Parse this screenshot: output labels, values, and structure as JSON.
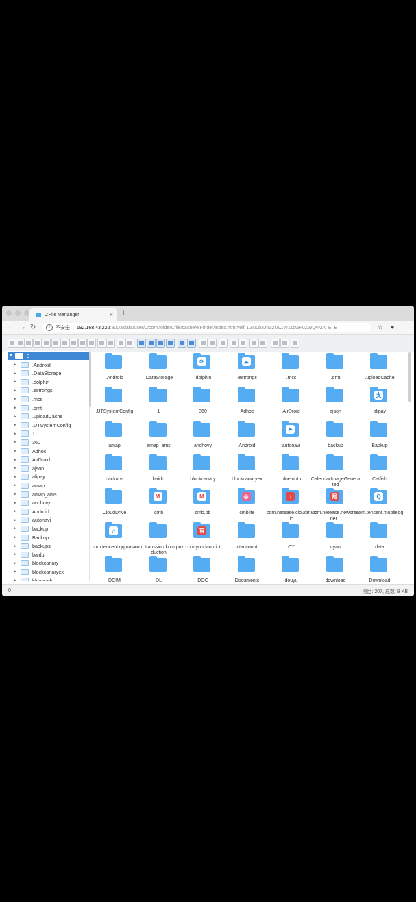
{
  "browser": {
    "tab_title": "0:File Mananger",
    "insecure_label": "不安全",
    "url_host": "192.168.43.222",
    "url_path": ":8000/data/user/0/com.folderv.file/cache/elFinder/index.html#elf_L3N0b3JhZ2UvZW11bGF0ZWQvMA_E_E"
  },
  "tree": {
    "root": "0",
    "items": [
      ".Android",
      ".DataStorage",
      ".dolphin",
      ".estrongs",
      ".mcs",
      ".qmt",
      ".uploadCache",
      ".UTSystemConfig",
      "1",
      "360",
      "Adhoc",
      "AirDroid",
      "ajson",
      "alipay",
      "amap",
      "amap_ams",
      "anchovy",
      "Android",
      "autonavi",
      "backup",
      "Backup",
      "backups",
      "baidu",
      "blockcanary",
      "blockcanaryex",
      "bluetooth"
    ]
  },
  "files": [
    {
      "name": ".Android",
      "icon": "folder-icon"
    },
    {
      "name": ".DataStorage",
      "icon": "folder-icon"
    },
    {
      "name": ".dolphin",
      "icon": "dolphin-app-icon"
    },
    {
      "name": ".estrongs",
      "icon": "estrongs-app-icon"
    },
    {
      "name": ".mcs",
      "icon": "folder-icon"
    },
    {
      "name": ".qmt",
      "icon": "folder-icon"
    },
    {
      "name": ".uploadCache",
      "icon": "folder-icon"
    },
    {
      "name": ".UTSystemConfig",
      "icon": "folder-icon"
    },
    {
      "name": "1",
      "icon": "folder-icon"
    },
    {
      "name": "360",
      "icon": "folder-icon"
    },
    {
      "name": "Adhoc",
      "icon": "folder-icon"
    },
    {
      "name": "AirDroid",
      "icon": "folder-icon"
    },
    {
      "name": "ajson",
      "icon": "folder-icon"
    },
    {
      "name": "alipay",
      "icon": "alipay-app-icon"
    },
    {
      "name": "amap",
      "icon": "folder-icon"
    },
    {
      "name": "amap_ams",
      "icon": "folder-icon"
    },
    {
      "name": "anchovy",
      "icon": "folder-icon"
    },
    {
      "name": "Android",
      "icon": "folder-icon"
    },
    {
      "name": "autonavi",
      "icon": "autonavi-app-icon"
    },
    {
      "name": "backup",
      "icon": "folder-icon"
    },
    {
      "name": "Backup",
      "icon": "folder-icon"
    },
    {
      "name": "backups",
      "icon": "folder-icon"
    },
    {
      "name": "baidu",
      "icon": "folder-icon"
    },
    {
      "name": "blockcanary",
      "icon": "folder-icon"
    },
    {
      "name": "blockcanaryex",
      "icon": "folder-icon"
    },
    {
      "name": "bluetooth",
      "icon": "folder-icon"
    },
    {
      "name": "CalendarImageGenerated",
      "icon": "folder-icon"
    },
    {
      "name": "Catfish",
      "icon": "folder-icon"
    },
    {
      "name": "CloudDrive",
      "icon": "folder-icon"
    },
    {
      "name": "cmb",
      "icon": "cmb-app-icon"
    },
    {
      "name": "cmb.pb",
      "icon": "cmb-app-icon"
    },
    {
      "name": "cmblife",
      "icon": "cmblife-app-icon"
    },
    {
      "name": "com.netease.cloudmusic",
      "icon": "cloudmusic-app-icon"
    },
    {
      "name": "com.netease.newsreader...",
      "icon": "newsreader-app-icon"
    },
    {
      "name": "com.tencent.mobileqq",
      "icon": "qq-app-icon"
    },
    {
      "name": "com.tencent.qqmusic",
      "icon": "qqmusic-app-icon"
    },
    {
      "name": "com.transsion.kom.production",
      "icon": "folder-icon"
    },
    {
      "name": "com.youdao.dict",
      "icon": "youdao-app-icon"
    },
    {
      "name": "ctaccount",
      "icon": "folder-icon"
    },
    {
      "name": "CY",
      "icon": "folder-icon"
    },
    {
      "name": "cyan",
      "icon": "folder-icon"
    },
    {
      "name": "data",
      "icon": "folder-icon"
    },
    {
      "name": "DCIM",
      "icon": "folder-icon"
    },
    {
      "name": "DL",
      "icon": "folder-icon"
    },
    {
      "name": "DOC",
      "icon": "folder-icon"
    },
    {
      "name": "Documents",
      "icon": "folder-icon"
    },
    {
      "name": "douyu",
      "icon": "folder-icon"
    },
    {
      "name": "download",
      "icon": "folder-icon"
    },
    {
      "name": "Download",
      "icon": "folder-icon"
    }
  ],
  "status": {
    "left": "0",
    "right": "项目: 207, 总数: 8 KB"
  }
}
